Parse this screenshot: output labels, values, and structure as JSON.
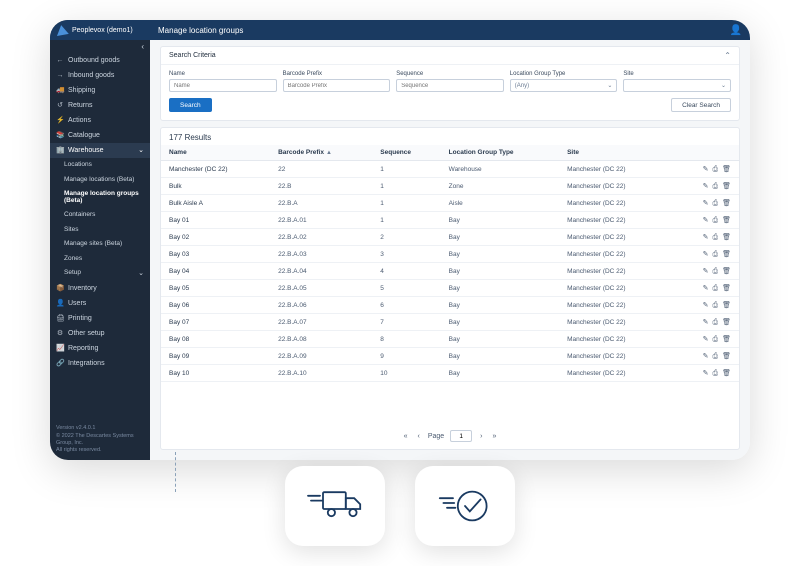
{
  "brand": "Peoplevox (demo1)",
  "pageTitle": "Manage location groups",
  "sidebar": {
    "items": [
      {
        "icon": "←",
        "label": "Outbound goods"
      },
      {
        "icon": "→",
        "label": "Inbound goods"
      },
      {
        "icon": "🚚",
        "label": "Shipping"
      },
      {
        "icon": "↺",
        "label": "Returns"
      },
      {
        "icon": "⚡",
        "label": "Actions"
      },
      {
        "icon": "📚",
        "label": "Catalogue"
      },
      {
        "icon": "🏢",
        "label": "Warehouse"
      }
    ],
    "warehouseSub": [
      {
        "label": "Locations"
      },
      {
        "label": "Manage locations (Beta)"
      },
      {
        "label": "Manage location groups (Beta)"
      },
      {
        "label": "Containers"
      },
      {
        "label": "Sites"
      },
      {
        "label": "Manage sites (Beta)"
      },
      {
        "label": "Zones"
      },
      {
        "label": "Setup"
      }
    ],
    "items2": [
      {
        "icon": "📦",
        "label": "Inventory"
      },
      {
        "icon": "👤",
        "label": "Users"
      },
      {
        "icon": "🖨",
        "label": "Printing"
      },
      {
        "icon": "⚙",
        "label": "Other setup"
      },
      {
        "icon": "📈",
        "label": "Reporting"
      },
      {
        "icon": "🔗",
        "label": "Integrations"
      }
    ],
    "footer1": "Version v2.4.0.1",
    "footer2": "© 2022 The Descartes Systems Group, Inc.",
    "footer3": "All rights reserved."
  },
  "search": {
    "panelTitle": "Search Criteria",
    "fields": {
      "name": {
        "label": "Name",
        "placeholder": "Name"
      },
      "barcode": {
        "label": "Barcode Prefix",
        "placeholder": "Barcode Prefix"
      },
      "sequence": {
        "label": "Sequence",
        "placeholder": "Sequence"
      },
      "type": {
        "label": "Location Group Type",
        "value": "(Any)"
      },
      "site": {
        "label": "Site",
        "value": ""
      }
    },
    "searchBtn": "Search",
    "clearBtn": "Clear Search"
  },
  "results": {
    "countLabel": "177 Results",
    "columns": {
      "name": "Name",
      "barcode": "Barcode Prefix",
      "sequence": "Sequence",
      "type": "Location Group Type",
      "site": "Site"
    },
    "rows": [
      {
        "name": "Manchester (DC 22)",
        "barcode": "22",
        "sequence": "1",
        "type": "Warehouse",
        "site": "Manchester (DC 22)"
      },
      {
        "name": "Bulk",
        "barcode": "22.B",
        "sequence": "1",
        "type": "Zone",
        "site": "Manchester (DC 22)"
      },
      {
        "name": "Bulk Aisle A",
        "barcode": "22.B.A",
        "sequence": "1",
        "type": "Aisle",
        "site": "Manchester (DC 22)"
      },
      {
        "name": "Bay 01",
        "barcode": "22.B.A.01",
        "sequence": "1",
        "type": "Bay",
        "site": "Manchester (DC 22)"
      },
      {
        "name": "Bay 02",
        "barcode": "22.B.A.02",
        "sequence": "2",
        "type": "Bay",
        "site": "Manchester (DC 22)"
      },
      {
        "name": "Bay 03",
        "barcode": "22.B.A.03",
        "sequence": "3",
        "type": "Bay",
        "site": "Manchester (DC 22)"
      },
      {
        "name": "Bay 04",
        "barcode": "22.B.A.04",
        "sequence": "4",
        "type": "Bay",
        "site": "Manchester (DC 22)"
      },
      {
        "name": "Bay 05",
        "barcode": "22.B.A.05",
        "sequence": "5",
        "type": "Bay",
        "site": "Manchester (DC 22)"
      },
      {
        "name": "Bay 06",
        "barcode": "22.B.A.06",
        "sequence": "6",
        "type": "Bay",
        "site": "Manchester (DC 22)"
      },
      {
        "name": "Bay 07",
        "barcode": "22.B.A.07",
        "sequence": "7",
        "type": "Bay",
        "site": "Manchester (DC 22)"
      },
      {
        "name": "Bay 08",
        "barcode": "22.B.A.08",
        "sequence": "8",
        "type": "Bay",
        "site": "Manchester (DC 22)"
      },
      {
        "name": "Bay 09",
        "barcode": "22.B.A.09",
        "sequence": "9",
        "type": "Bay",
        "site": "Manchester (DC 22)"
      },
      {
        "name": "Bay 10",
        "barcode": "22.B.A.10",
        "sequence": "10",
        "type": "Bay",
        "site": "Manchester (DC 22)"
      }
    ],
    "pager": {
      "pageLabel": "Page",
      "value": "1"
    }
  }
}
